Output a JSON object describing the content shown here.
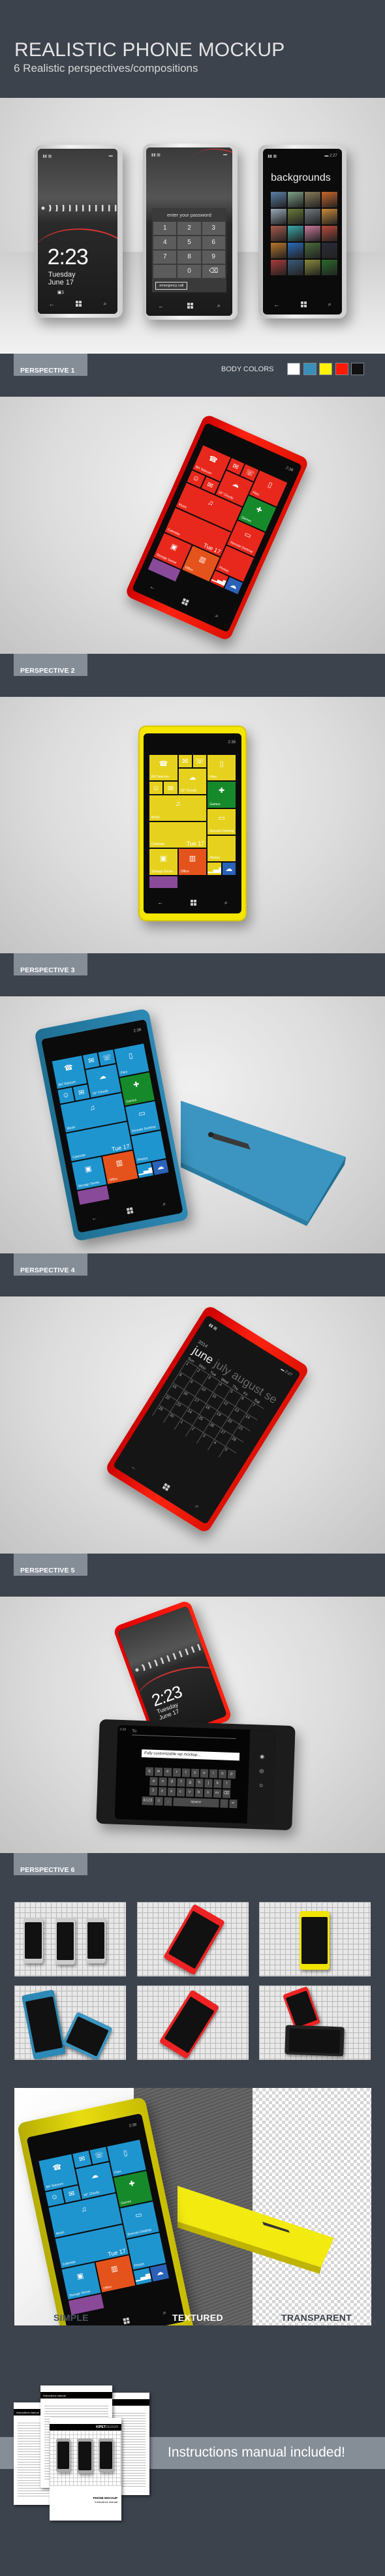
{
  "header": {
    "title": "REALISTIC PHONE MOCKUP",
    "subtitle": "6 Realistic perspectives/compositions"
  },
  "sections": [
    {
      "label": "PERSPECTIVE 1"
    },
    {
      "label": "PERSPECTIVE 2"
    },
    {
      "label": "PERSPECTIVE 3"
    },
    {
      "label": "PERSPECTIVE 4"
    },
    {
      "label": "PERSPECTIVE 5"
    },
    {
      "label": "PERSPECTIVE 6"
    }
  ],
  "body_colors": {
    "label": "BODY COLORS",
    "colors": [
      "#ffffff",
      "#3a8fb8",
      "#fff200",
      "#ff1a00",
      "#111111"
    ]
  },
  "lock_screen": {
    "time": "2:23",
    "day": "Tuesday",
    "date": "June 17",
    "notification": "1"
  },
  "password_screen": {
    "title": "enter your password",
    "keys": [
      "1",
      "2",
      "3",
      "4",
      "5",
      "6",
      "7",
      "8",
      "9",
      "0"
    ],
    "emergency": "emergency call"
  },
  "backgrounds_screen": {
    "title": "backgrounds",
    "status_time": "2:27"
  },
  "tiles": {
    "status_time": "2:38",
    "weather_temp": "16°",
    "weather_desc": "Cloudy",
    "calendar_day": "Tue",
    "calendar_date": "17",
    "labels": {
      "telecom": "BH Telecom",
      "files": "Files",
      "music": "Music",
      "games": "Games",
      "calendar": "Calendar",
      "remote": "Remote Desktop",
      "storage": "Storage Sense",
      "office": "Office",
      "photos": "Photos"
    },
    "colors": {
      "green": "#168a2a",
      "office": "#e5531c",
      "onedrive": "#2a62b8",
      "purple": "#8a4a9a"
    }
  },
  "calendar_screen": {
    "year": "2014",
    "months": [
      "june",
      "july",
      "august",
      "se"
    ],
    "weekdays": [
      "Sun",
      "Mon",
      "Tue",
      "Wed",
      "Thu",
      "Fri",
      "Sat"
    ],
    "weeks": [
      [
        "1",
        "2",
        "3",
        "4",
        "5",
        "6",
        "7"
      ],
      [
        "8",
        "9",
        "10",
        "11",
        "12",
        "13",
        "14"
      ],
      [
        "15",
        "16",
        "17",
        "18",
        "19",
        "20",
        "21"
      ],
      [
        "22",
        "23",
        "24",
        "25",
        "26",
        "27",
        "28"
      ],
      [
        "29",
        "30",
        "1",
        "2",
        "3",
        "4",
        "5"
      ]
    ],
    "status_time": "2:27"
  },
  "keyboard_screen": {
    "status_time": "2:29",
    "to_label": "To:",
    "message": "Fully customizable wp mockup...",
    "rows": [
      [
        "q",
        "w",
        "e",
        "r",
        "t",
        "y",
        "u",
        "i",
        "o",
        "p"
      ],
      [
        "a",
        "s",
        "d",
        "f",
        "g",
        "h",
        "j",
        "k",
        "l"
      ],
      [
        "z",
        "x",
        "c",
        "v",
        "b",
        "n",
        "m"
      ]
    ],
    "symbols_key": "&123",
    "comma_key": ",",
    "space_key": "space",
    "period_key": "."
  },
  "composition": {
    "labels": [
      "SIMPLE",
      "TEXTURED",
      "TRANSPARENT"
    ]
  },
  "manual": {
    "banner": "Instructions manual included!",
    "page_header": "Instructions manual",
    "brand_bold": "KIPET",
    "brand_light": "DESIGN",
    "cover_title": "PHONE MOCKUP",
    "cover_subtitle": "Instructions manual"
  }
}
